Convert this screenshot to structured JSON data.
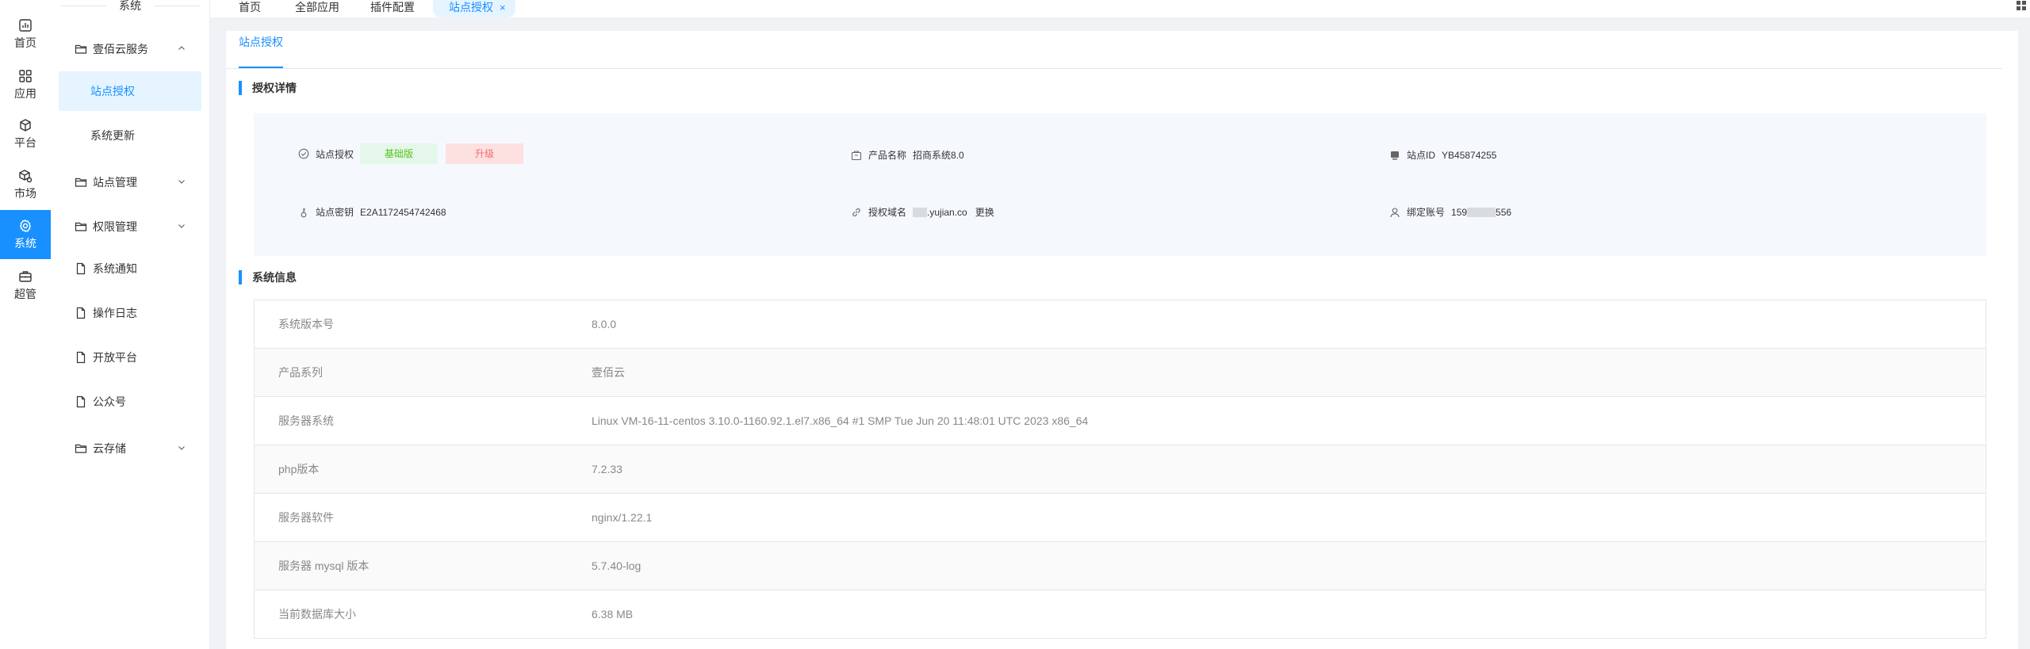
{
  "rail": {
    "items": [
      {
        "label": "首页",
        "icon": "dashboard-icon"
      },
      {
        "label": "应用",
        "icon": "apps-icon"
      },
      {
        "label": "平台",
        "icon": "cube-icon"
      },
      {
        "label": "市场",
        "icon": "market-icon"
      },
      {
        "label": "系统",
        "icon": "gear-icon"
      },
      {
        "label": "超管",
        "icon": "toolbox-icon"
      }
    ],
    "active_color": "#1890ff"
  },
  "submenu": {
    "header": "系统",
    "items": [
      {
        "label": "壹佰云服务"
      },
      {
        "label": "站点授权"
      },
      {
        "label": "系统更新"
      },
      {
        "label": "站点管理"
      },
      {
        "label": "权限管理"
      },
      {
        "label": "系统通知"
      },
      {
        "label": "操作日志"
      },
      {
        "label": "开放平台"
      },
      {
        "label": "公众号"
      },
      {
        "label": "云存储"
      }
    ]
  },
  "tabs": {
    "items": [
      "首页",
      "全部应用",
      "插件配置",
      "站点授权"
    ],
    "close": "×"
  },
  "content": {
    "subtab": "站点授权",
    "auth": {
      "title": "授权详情",
      "site_auth_label": "站点授权",
      "edition_badge": "基础版",
      "upgrade_badge": "升级",
      "product_label": "产品名称",
      "product_value": "招商系统8.0",
      "site_id_label": "站点ID",
      "site_id_value": "YB45874255",
      "key_label": "站点密钥",
      "key_value": "E2A1172454742468",
      "domain_label": "授权域名",
      "domain_value": ".yujian.co",
      "domain_change": "更换",
      "account_label": "绑定账号",
      "account_prefix": "159",
      "account_suffix": "556"
    },
    "sysinfo": {
      "title": "系统信息",
      "rows": [
        {
          "k": "系统版本号",
          "v": "8.0.0"
        },
        {
          "k": "产品系列",
          "v": "壹佰云"
        },
        {
          "k": "服务器系统",
          "v": "Linux VM-16-11-centos 3.10.0-1160.92.1.el7.x86_64 #1 SMP Tue Jun 20 11:48:01 UTC 2023 x86_64"
        },
        {
          "k": "php版本",
          "v": "7.2.33"
        },
        {
          "k": "服务器软件",
          "v": "nginx/1.22.1"
        },
        {
          "k": "服务器 mysql 版本",
          "v": "5.7.40-log"
        },
        {
          "k": "当前数据库大小",
          "v": "6.38 MB"
        }
      ]
    }
  }
}
